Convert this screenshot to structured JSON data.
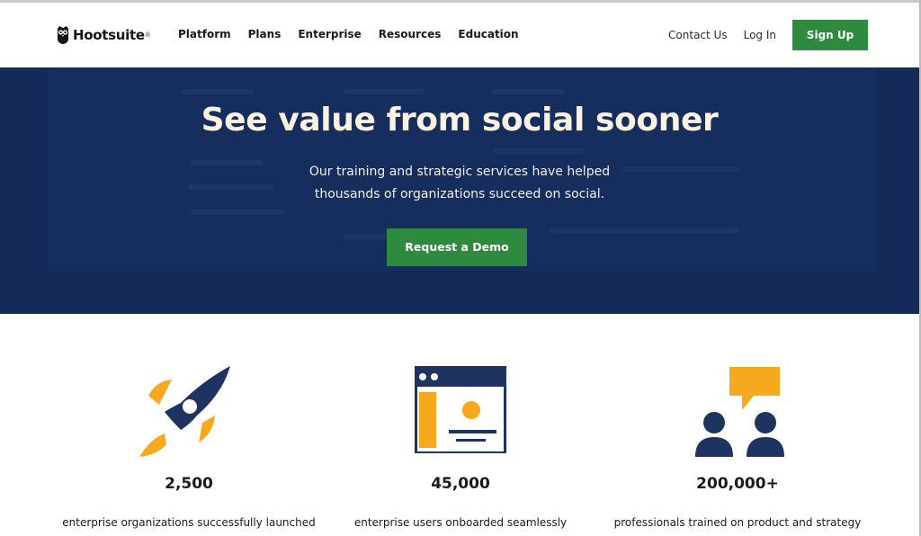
{
  "brand": {
    "name": "Hootsuite",
    "trademark": "®"
  },
  "nav": {
    "items": [
      {
        "label": "Platform"
      },
      {
        "label": "Plans"
      },
      {
        "label": "Enterprise"
      },
      {
        "label": "Resources"
      },
      {
        "label": "Education"
      }
    ],
    "contact_label": "Contact Us",
    "login_label": "Log In",
    "signup_label": "Sign Up"
  },
  "hero": {
    "title": "See value from social sooner",
    "subtitle_line1": "Our training and strategic services have helped",
    "subtitle_line2": "thousands of organizations succeed on social.",
    "cta_label": "Request a Demo"
  },
  "stats": [
    {
      "icon": "rocket-icon",
      "value": "2,500",
      "description": "enterprise organizations successfully launched"
    },
    {
      "icon": "browser-window-icon",
      "value": "45,000",
      "description": "enterprise users onboarded seamlessly"
    },
    {
      "icon": "people-chat-icon",
      "value": "200,000+",
      "description": "professionals trained on product and strategy"
    }
  ],
  "colors": {
    "hero_background": "#142b5a",
    "accent_green": "#2e8a3e",
    "icon_navy": "#1d3461",
    "icon_yellow": "#f6a91c",
    "hero_title": "#fbf2e2"
  }
}
